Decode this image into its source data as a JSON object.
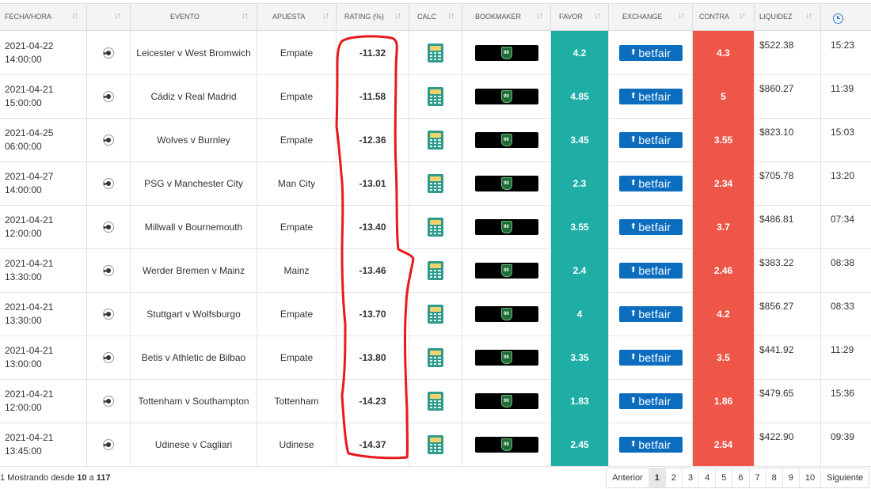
{
  "headers": {
    "fecha": "FECHA/HORA",
    "evento": "EVENTO",
    "apuesta": "APUESTA",
    "rating": "RATING (%)",
    "calc": "CALC",
    "bookmaker": "BOOKMAKER",
    "favor": "FAVOR",
    "exchange": "EXCHANGE",
    "contra": "CONTRA",
    "liquidez": "LIQUIDEZ",
    "sort_glyph": "↓↑",
    "clock_icon": "clock-icon"
  },
  "colors": {
    "favor_bg": "#1faea5",
    "contra_bg": "#ee5648",
    "betfair_bg": "#0c6dbf",
    "annotation": "#e8191c"
  },
  "bookmaker_badge": "90",
  "exchange_label": "betfair",
  "rows": [
    {
      "date": "2021-04-22",
      "time": "14:00:00",
      "evento": "Leicester v West Bromwich",
      "apuesta": "Empate",
      "rating": "-11.32",
      "favor": "4.2",
      "contra": "4.3",
      "liquidez": "$522.38",
      "hora": "15:23"
    },
    {
      "date": "2021-04-21",
      "time": "15:00:00",
      "evento": "Cádiz v Real Madrid",
      "apuesta": "Empate",
      "rating": "-11.58",
      "favor": "4.85",
      "contra": "5",
      "liquidez": "$860.27",
      "hora": "11:39"
    },
    {
      "date": "2021-04-25",
      "time": "06:00:00",
      "evento": "Wolves v Burnley",
      "apuesta": "Empate",
      "rating": "-12.36",
      "favor": "3.45",
      "contra": "3.55",
      "liquidez": "$823.10",
      "hora": "15:03"
    },
    {
      "date": "2021-04-27",
      "time": "14:00:00",
      "evento": "PSG v Manchester City",
      "apuesta": "Man City",
      "rating": "-13.01",
      "favor": "2.3",
      "contra": "2.34",
      "liquidez": "$705.78",
      "hora": "13:20"
    },
    {
      "date": "2021-04-21",
      "time": "12:00:00",
      "evento": "Millwall v Bournemouth",
      "apuesta": "Empate",
      "rating": "-13.40",
      "favor": "3.55",
      "contra": "3.7",
      "liquidez": "$486.81",
      "hora": "07:34"
    },
    {
      "date": "2021-04-21",
      "time": "13:30:00",
      "evento": "Werder Bremen v Mainz",
      "apuesta": "Mainz",
      "rating": "-13.46",
      "favor": "2.4",
      "contra": "2.46",
      "liquidez": "$383.22",
      "hora": "08:38"
    },
    {
      "date": "2021-04-21",
      "time": "13:30:00",
      "evento": "Stuttgart v Wolfsburgo",
      "apuesta": "Empate",
      "rating": "-13.70",
      "favor": "4",
      "contra": "4.2",
      "liquidez": "$856.27",
      "hora": "08:33"
    },
    {
      "date": "2021-04-21",
      "time": "13:00:00",
      "evento": "Betis v Athletic de Bilbao",
      "apuesta": "Empate",
      "rating": "-13.80",
      "favor": "3.35",
      "contra": "3.5",
      "liquidez": "$441.92",
      "hora": "11:29"
    },
    {
      "date": "2021-04-21",
      "time": "12:00:00",
      "evento": "Tottenham v Southampton",
      "apuesta": "Tottenham",
      "rating": "-14.23",
      "favor": "1.83",
      "contra": "1.86",
      "liquidez": "$479.65",
      "hora": "15:36"
    },
    {
      "date": "2021-04-21",
      "time": "13:45:00",
      "evento": "Udinese v Cagliari",
      "apuesta": "Udinese",
      "rating": "-14.37",
      "favor": "2.45",
      "contra": "2.54",
      "liquidez": "$422.90",
      "hora": "09:39"
    }
  ],
  "footer": {
    "prefix": "1 Mostrando desde ",
    "from": "10",
    "mid": " a ",
    "to": "117"
  },
  "pagination": {
    "prev": "Anterior",
    "pages": [
      "1",
      "2",
      "3",
      "4",
      "5",
      "6",
      "7",
      "8",
      "9",
      "10"
    ],
    "active": "1",
    "next": "Siguiente"
  }
}
